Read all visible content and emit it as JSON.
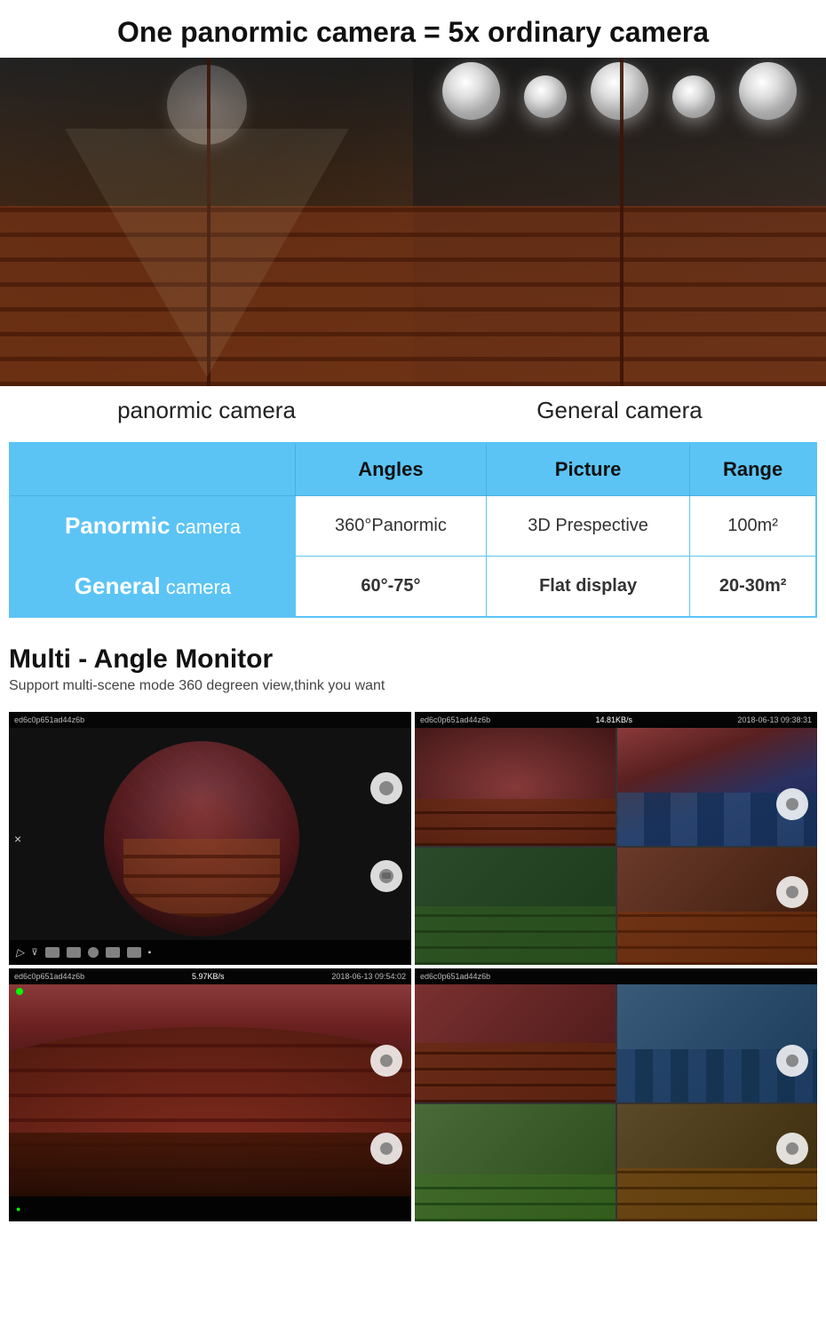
{
  "header": {
    "title": "One panormic camera = 5x ordinary camera"
  },
  "camera_labels": {
    "left": "panormic camera",
    "right": "General camera"
  },
  "table": {
    "headers": [
      "",
      "Angles",
      "Picture",
      "Range"
    ],
    "rows": [
      {
        "name": "Panormic camera",
        "name_bold": "Panormic",
        "name_rest": " camera",
        "angles": "360°Panormic",
        "picture": "3D Prespective",
        "range": "100m²"
      },
      {
        "name": "General camera",
        "name_bold": "General",
        "name_rest": " camera",
        "angles": "60°-75°",
        "picture": "Flat display",
        "range": "20-30m²"
      }
    ]
  },
  "multi_angle": {
    "title": "Multi - Angle Monitor",
    "description": "Support multi-scene mode 360 degreen view,think you want"
  },
  "monitor_cells": [
    {
      "id": "ed6c0p651ad44z6b",
      "time": "",
      "speed": "",
      "type": "fisheye_single"
    },
    {
      "id": "ed6c0p651ad44z6b",
      "time": "2018-06-13 09:38:31",
      "speed": "14.81KB/s",
      "type": "multiview"
    },
    {
      "id": "ed6c0p651ad44z6b",
      "time": "2018-06-13 09:54:02",
      "speed": "5.97KB/s",
      "type": "panoramic_wide"
    },
    {
      "id": "ed6c0p651ad44z6b",
      "time": "",
      "speed": "",
      "type": "multiview2"
    }
  ],
  "colors": {
    "accent_blue": "#5bc4f5",
    "text_dark": "#111111",
    "table_bg": "#5bc4f5"
  }
}
